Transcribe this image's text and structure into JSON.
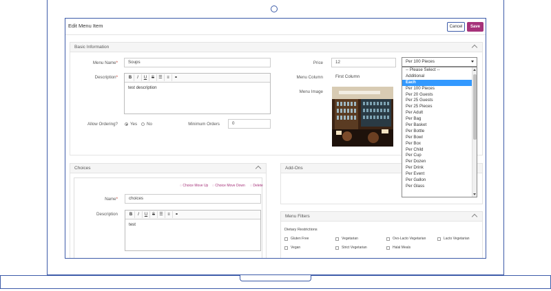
{
  "page": {
    "title": "Edit Menu Item",
    "cancel_label": "Cancel",
    "save_label": "Save"
  },
  "basic_info": {
    "header": "Basic Information",
    "menu_name_label": "Menu Name",
    "menu_name_value": "Soups",
    "description_label": "Description",
    "description_value": "test description",
    "allow_ordering_label": "Allow Ordering?",
    "yes_label": "Yes",
    "no_label": "No",
    "min_orders_label": "Minimum Orders",
    "min_orders_value": "0",
    "price_label": "Price",
    "price_value": "12",
    "menu_column_label": "Menu Column",
    "menu_column_value": "First Column",
    "menu_image_label": "Menu Image"
  },
  "toolbar": {
    "bold": "B",
    "italic": "I",
    "underline": "U",
    "strike": "S"
  },
  "price_unit": {
    "selected": "Per 100 Pieces",
    "options": [
      "-- Please Select --",
      "Additional",
      "Each",
      "Per 100 Pieces",
      "Per 20 Guests",
      "Per 25 Guests",
      "Per 25 Pieces",
      "Per Adult",
      "Per Bag",
      "Per Basket",
      "Per Bottle",
      "Per Bowl",
      "Per Box",
      "Per Child",
      "Per Cup",
      "Per Dozen",
      "Per Drink",
      "Per Event",
      "Per Gallon",
      "Per Glass"
    ],
    "highlighted": "Each"
  },
  "choices": {
    "header": "Choices",
    "move_up": "Choice Move Up",
    "move_down": "Choice Move Down",
    "delete": "Delete",
    "name_label": "Name",
    "name_value": "choices",
    "description_label": "Description",
    "description_value": "test"
  },
  "addons": {
    "header": "Add-Ons"
  },
  "filters": {
    "header": "Menu Filters",
    "dietary_label": "Dietary Restrictions",
    "items": [
      "Gluten Free",
      "Vegetarian",
      "Ovo-Lacto Vegetarian",
      "Lacto Vegetarian",
      "Vegan",
      "Strict Vegetarian",
      "Halal Meals"
    ]
  },
  "colors": {
    "frame": "#3b5aa8",
    "accent": "#a6327a",
    "highlight": "#3399ff"
  }
}
